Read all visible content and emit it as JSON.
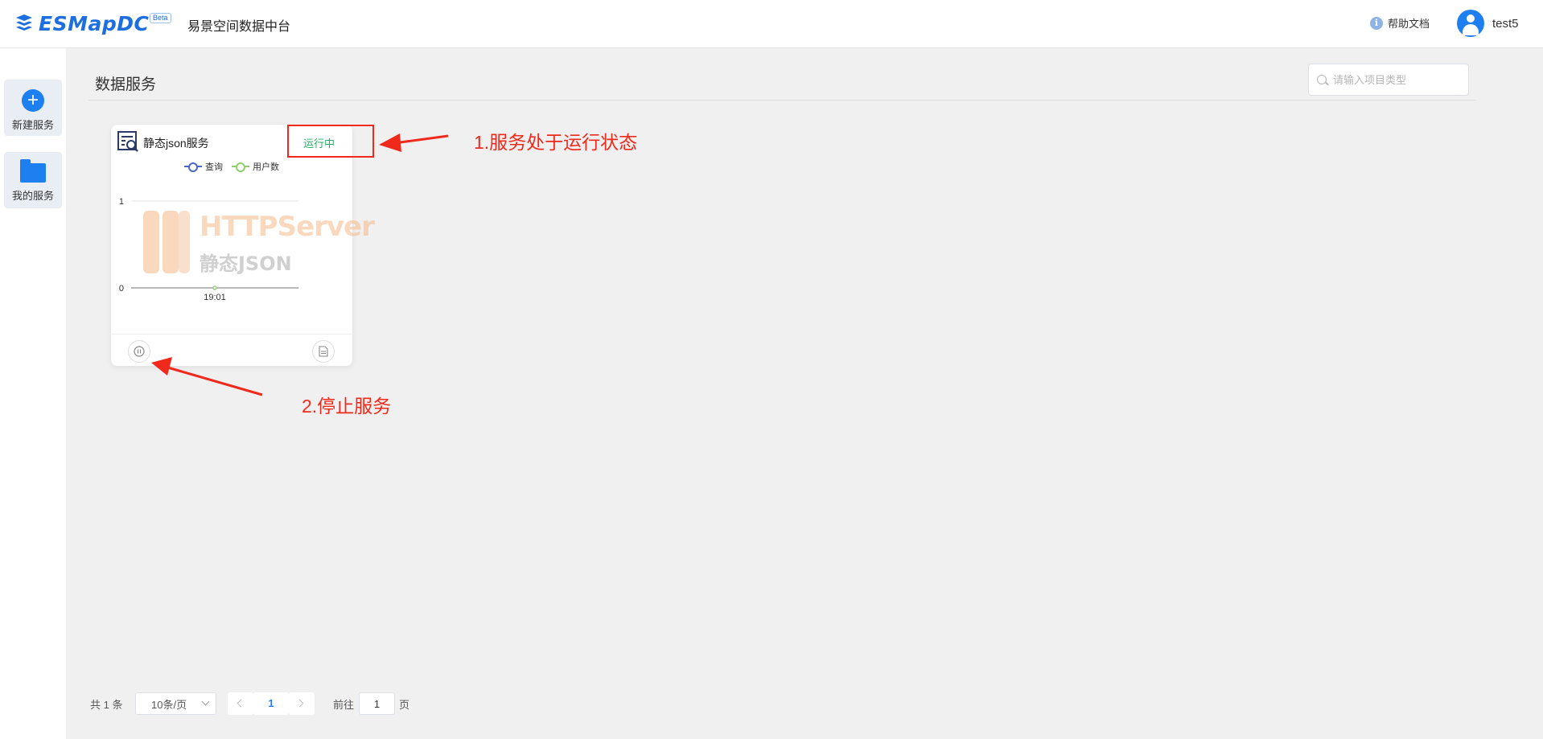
{
  "header": {
    "logo_text": "ESMapDC",
    "beta_badge": "Beta",
    "app_name": "易景空间数据中台",
    "help_label": "帮助文档",
    "username": "test5"
  },
  "sidebar": {
    "items": [
      {
        "label": "新建服务",
        "icon": "plus-icon"
      },
      {
        "label": "我的服务",
        "icon": "folder-icon"
      }
    ]
  },
  "main": {
    "page_title": "数据服务",
    "search_placeholder": "请输入项目类型"
  },
  "card": {
    "title": "静态json服务",
    "status": "运行中",
    "status_color": "#27ae60",
    "watermark_line1": "HTTPServer",
    "watermark_line2": "静态JSON"
  },
  "chart_data": {
    "type": "line",
    "x": [
      "19:01"
    ],
    "series": [
      {
        "name": "查询",
        "values": [
          0
        ],
        "color": "#4a66c8"
      },
      {
        "name": "用户数",
        "values": [
          0
        ],
        "color": "#8ccf6c"
      }
    ],
    "ylim": [
      0,
      1
    ],
    "yticks": [
      "1",
      "0"
    ]
  },
  "annotations": {
    "note1": "1.服务处于运行状态",
    "note2": "2.停止服务"
  },
  "pagination": {
    "total_text": "共 1 条",
    "page_size": "10条/页",
    "current_page": "1",
    "goto_label": "前往",
    "goto_value": "1",
    "page_unit": "页"
  },
  "colors": {
    "accent": "#1d7ff0",
    "annotation_red": "#ef2a1c"
  }
}
